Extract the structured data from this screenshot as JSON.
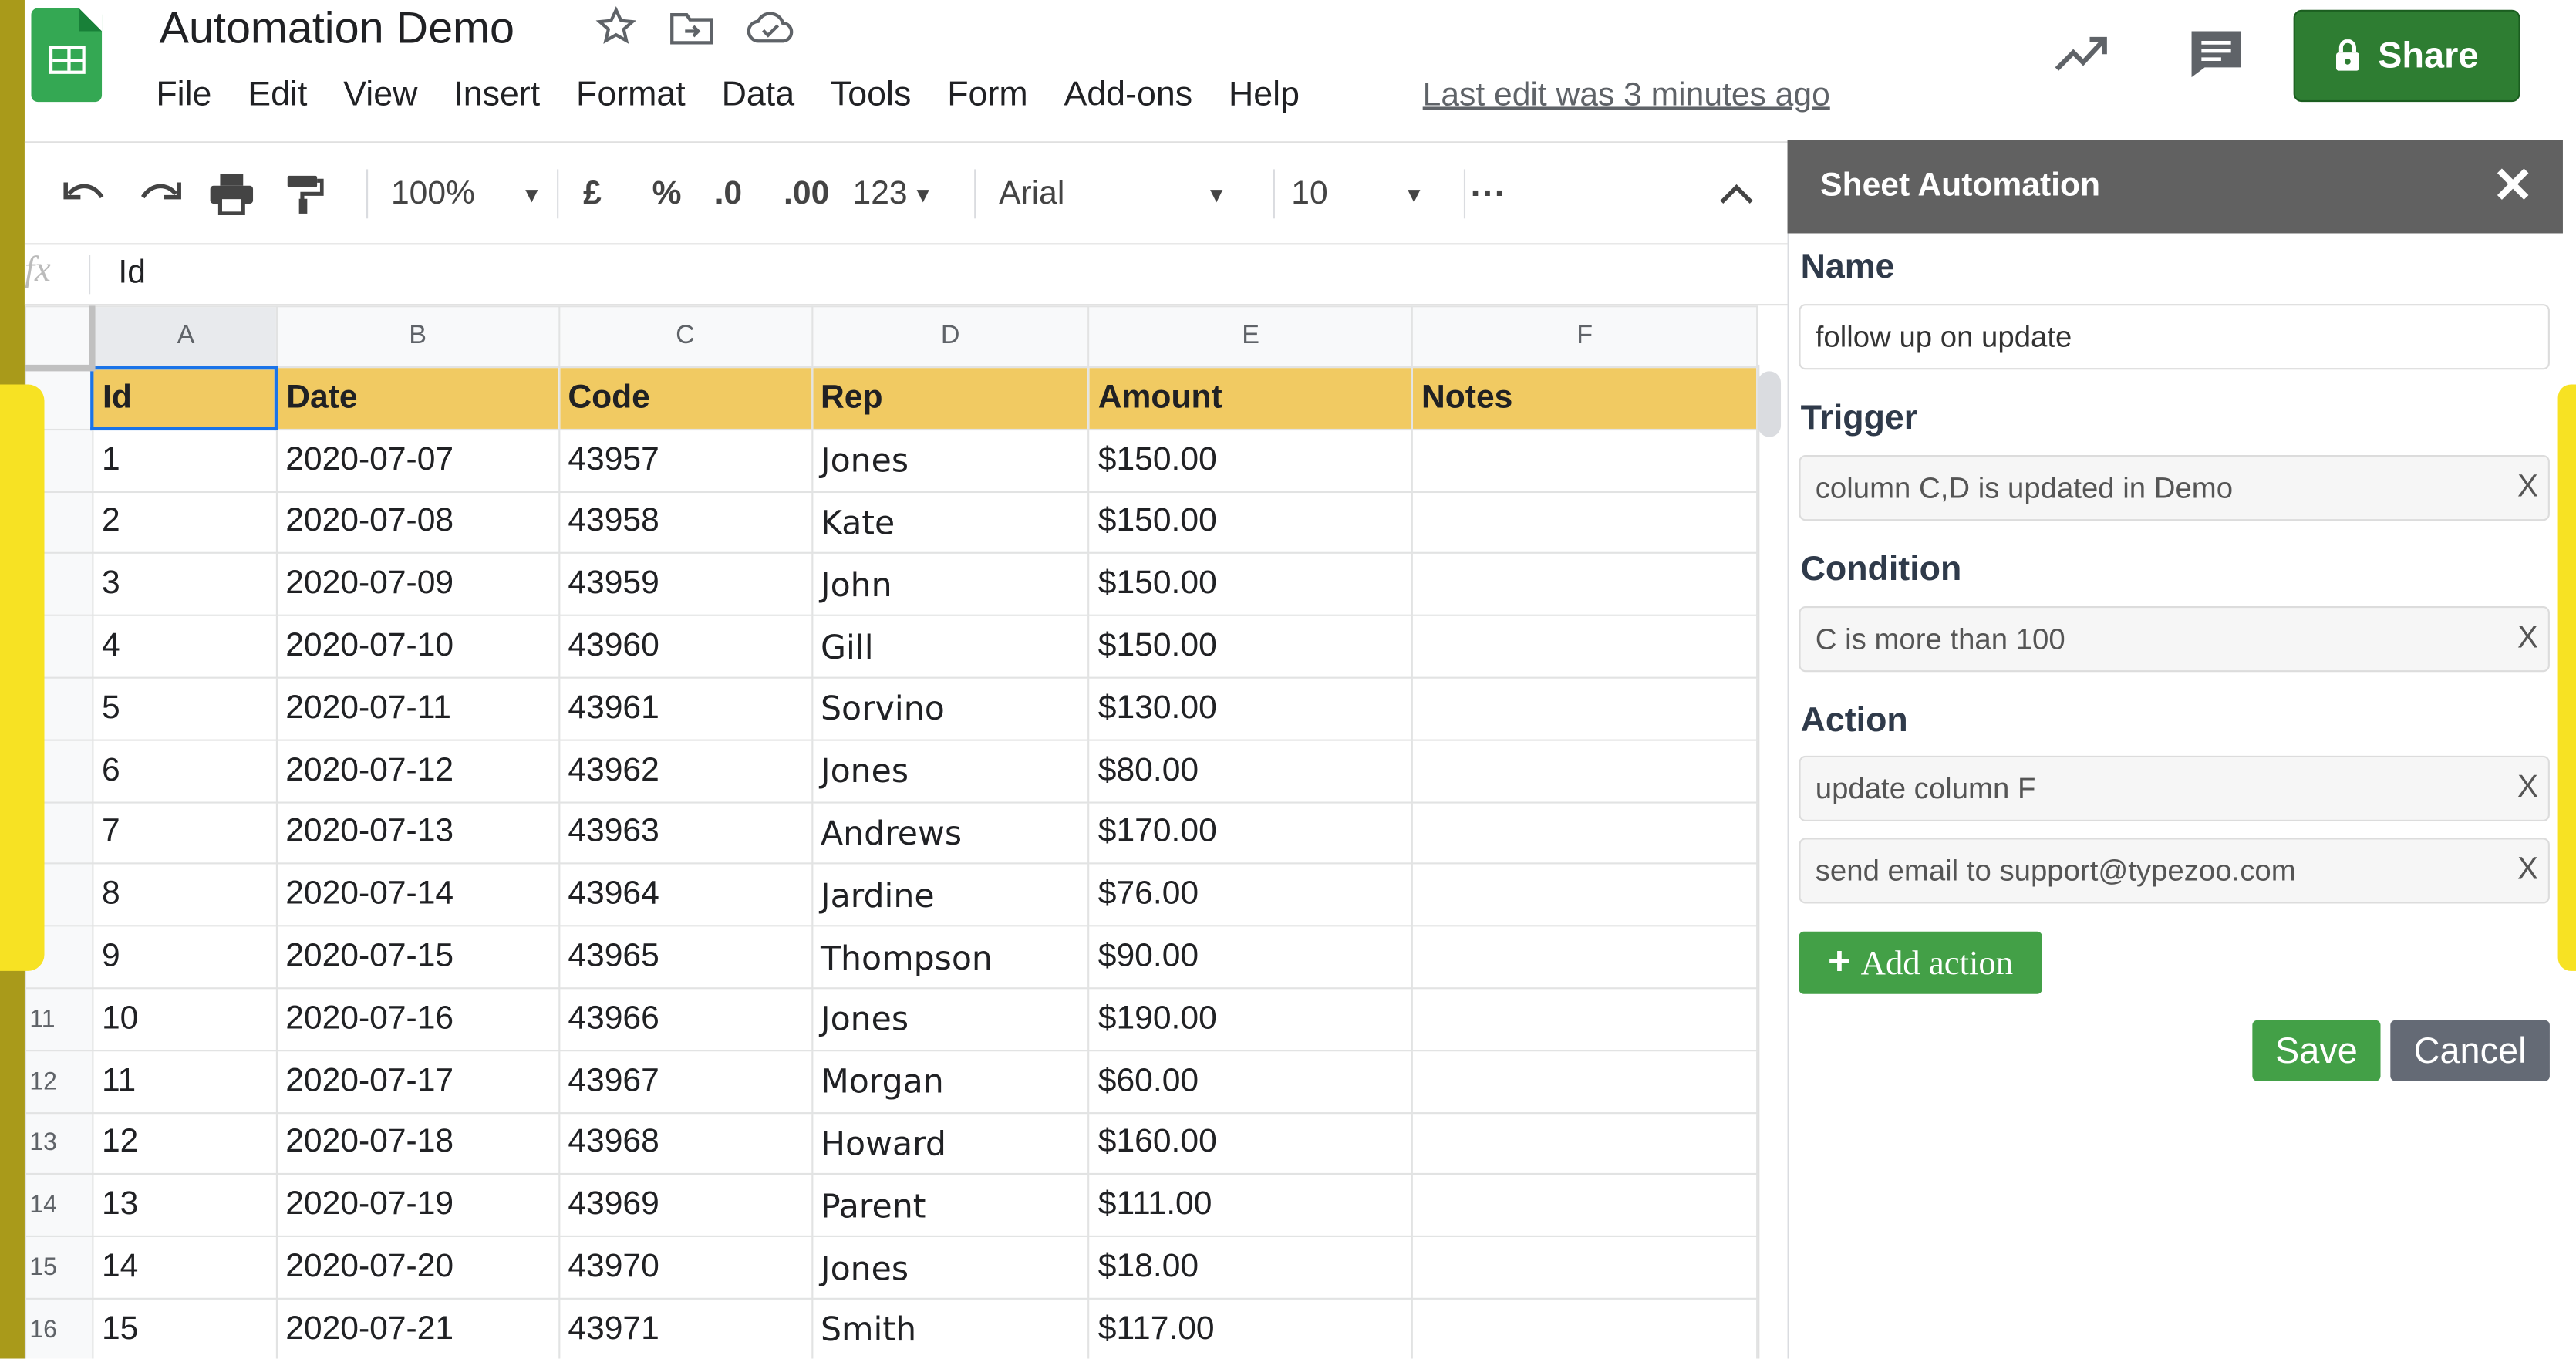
{
  "header": {
    "doc_title": "Automation Demo",
    "icons": [
      "star-icon",
      "move-to-folder-icon",
      "cloud-saved-icon"
    ],
    "menu": [
      "File",
      "Edit",
      "View",
      "Insert",
      "Format",
      "Data",
      "Tools",
      "Form",
      "Add-ons",
      "Help"
    ],
    "last_edit": "Last edit was 3 minutes ago",
    "share_label": "Share"
  },
  "toolbar": {
    "zoom": "100%",
    "currency": "£",
    "percent": "%",
    "decrease_decimal": ".0",
    "increase_decimal": ".00",
    "number_format": "123",
    "font": "Arial",
    "font_size": "10",
    "more": "···"
  },
  "formula_bar": {
    "fx": "fx",
    "value": "Id"
  },
  "sheet": {
    "column_letters": [
      "A",
      "B",
      "C",
      "D",
      "E",
      "F"
    ],
    "headers": [
      "Id",
      "Date",
      "Code",
      "Rep",
      "Amount",
      "Notes"
    ],
    "row_numbers": [
      "",
      "",
      "",
      "",
      "",
      "",
      "",
      "",
      "",
      "",
      "11",
      "12",
      "13",
      "14",
      "15",
      "16"
    ],
    "rows": [
      [
        "1",
        "2020-07-07",
        "43957",
        "Jones",
        "$150.00",
        ""
      ],
      [
        "2",
        "2020-07-08",
        "43958",
        "Kate",
        "$150.00",
        ""
      ],
      [
        "3",
        "2020-07-09",
        "43959",
        "John",
        "$150.00",
        ""
      ],
      [
        "4",
        "2020-07-10",
        "43960",
        "Gill",
        "$150.00",
        ""
      ],
      [
        "5",
        "2020-07-11",
        "43961",
        "Sorvino",
        "$130.00",
        ""
      ],
      [
        "6",
        "2020-07-12",
        "43962",
        "Jones",
        "$80.00",
        ""
      ],
      [
        "7",
        "2020-07-13",
        "43963",
        "Andrews",
        "$170.00",
        ""
      ],
      [
        "8",
        "2020-07-14",
        "43964",
        "Jardine",
        "$76.00",
        ""
      ],
      [
        "9",
        "2020-07-15",
        "43965",
        "Thompson",
        "$90.00",
        ""
      ],
      [
        "10",
        "2020-07-16",
        "43966",
        "Jones",
        "$190.00",
        ""
      ],
      [
        "11",
        "2020-07-17",
        "43967",
        "Morgan",
        "$60.00",
        ""
      ],
      [
        "12",
        "2020-07-18",
        "43968",
        "Howard",
        "$160.00",
        ""
      ],
      [
        "13",
        "2020-07-19",
        "43969",
        "Parent",
        "$111.00",
        ""
      ],
      [
        "14",
        "2020-07-20",
        "43970",
        "Jones",
        "$18.00",
        ""
      ],
      [
        "15",
        "2020-07-21",
        "43971",
        "Smith",
        "$117.00",
        ""
      ]
    ]
  },
  "panel": {
    "title": "Sheet Automation",
    "close": "✕",
    "name_label": "Name",
    "name_value": "follow up on update",
    "trigger_label": "Trigger",
    "trigger_value": "column C,D is updated in Demo",
    "condition_label": "Condition",
    "condition_value": "C is more than 100",
    "action_label": "Action",
    "actions": [
      "update column F",
      "send email to support@typezoo.com"
    ],
    "remove_mark": "X",
    "add_action_label": "Add action",
    "save_label": "Save",
    "cancel_label": "Cancel"
  },
  "colors": {
    "header_fill": "#f1ca62",
    "share_green": "#2e7d32",
    "panel_header": "#616161",
    "save_green": "#43a047",
    "cancel_gray": "#646a75",
    "accent_yellow": "#f7e223",
    "olive": "#a99a1a"
  }
}
